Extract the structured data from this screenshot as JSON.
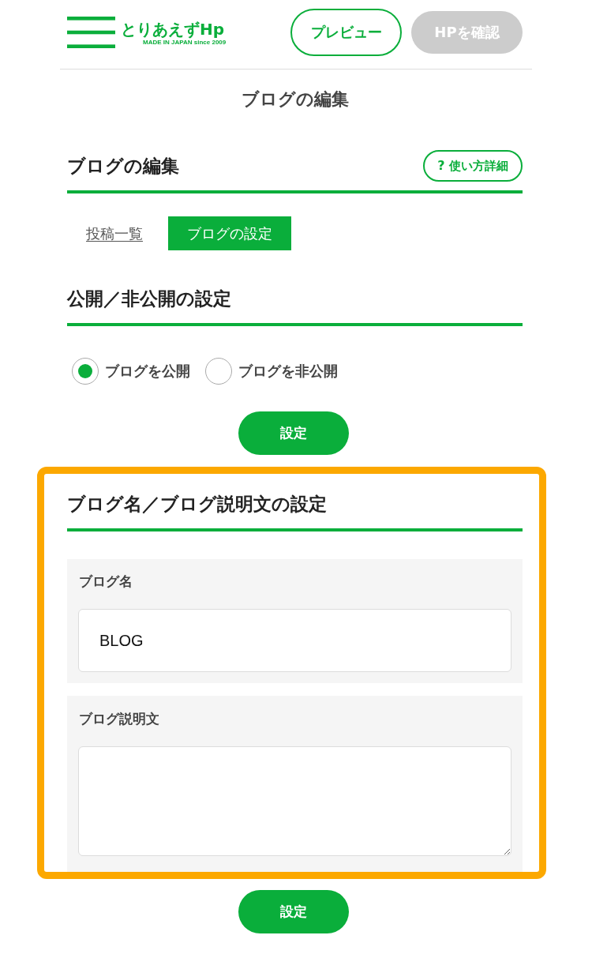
{
  "header": {
    "logo": {
      "name": "とりあえずHp",
      "tagline": "MADE IN JAPAN since 2009"
    },
    "buttons": [
      {
        "label": "プレビュー",
        "disabled": false
      },
      {
        "label": "HPを確認",
        "disabled": true
      }
    ]
  },
  "page_title": "ブログの編集",
  "blog_edit": {
    "title": "ブログの編集",
    "help_button": {
      "mark": "?",
      "label": "使い方詳細"
    },
    "tabs": [
      {
        "label": "投稿一覧",
        "selected": false
      },
      {
        "label": "ブログの設定",
        "selected": true
      }
    ]
  },
  "visibility": {
    "title": "公開／非公開の設定",
    "options": [
      {
        "label": "ブログを公開",
        "selected": true
      },
      {
        "label": "ブログを非公開",
        "selected": false
      }
    ],
    "submit": "設定"
  },
  "blog_info": {
    "title": "ブログ名／ブログ説明文の設定",
    "highlighted": true,
    "fields": [
      {
        "kind": "input",
        "label": "ブログ名",
        "value": "BLOG"
      },
      {
        "kind": "textarea",
        "label": "ブログ説明文"
      }
    ],
    "submit": "設定"
  }
}
